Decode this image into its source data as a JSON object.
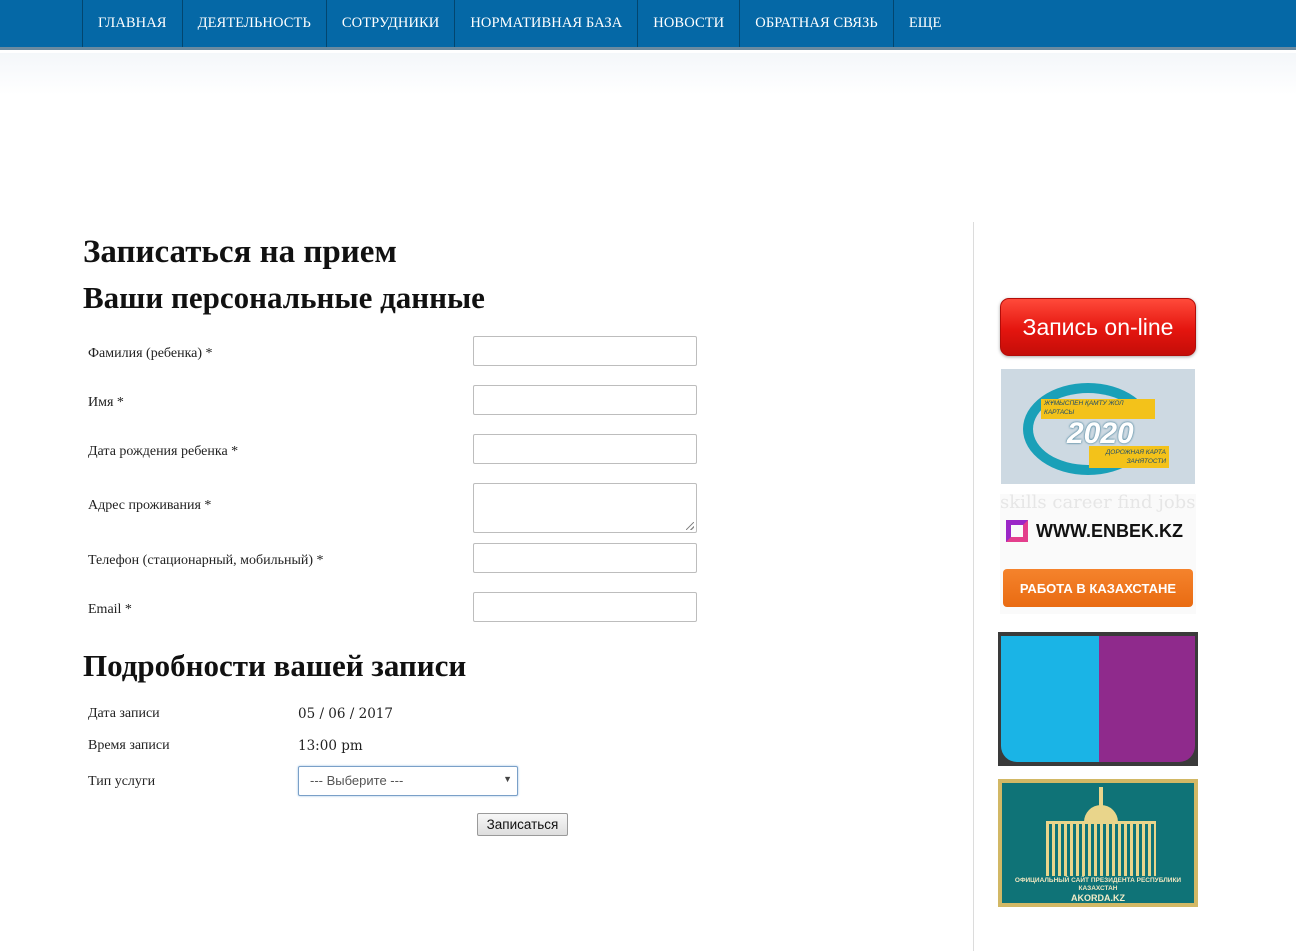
{
  "nav": {
    "items": [
      {
        "label": "ГЛАВНАЯ"
      },
      {
        "label": "ДЕЯТЕЛЬНОСТЬ"
      },
      {
        "label": "СОТРУДНИКИ"
      },
      {
        "label": "НОРМАТИВНАЯ БАЗА"
      },
      {
        "label": "НОВОСТИ"
      },
      {
        "label": "ОБРАТНАЯ СВЯЗЬ"
      },
      {
        "label": "ЕЩЕ"
      }
    ],
    "colors": {
      "background": "#0568a6",
      "divider": "#03466f"
    }
  },
  "page": {
    "title": "Записаться на прием",
    "personal_section_title": "Ваши персональные данные",
    "details_section_title": "Подробности вашей записи"
  },
  "personal_fields": [
    {
      "label": "Фамилия (ребенка) *",
      "value": "",
      "type": "text"
    },
    {
      "label": "Имя *",
      "value": "",
      "type": "text"
    },
    {
      "label": "Дата рождения ребенка *",
      "value": "",
      "type": "text"
    },
    {
      "label": "Адрес проживания *",
      "value": "",
      "type": "textarea"
    },
    {
      "label": "Телефон (стационарный, мобильный) *",
      "value": "",
      "type": "text"
    },
    {
      "label": "Email *",
      "value": "",
      "type": "text"
    }
  ],
  "details": {
    "date_label": "Дата записи",
    "date_value": "05 / 06 / 2017",
    "time_label": "Время записи",
    "time_value": "13:00 pm",
    "service_label": "Тип услуги",
    "service_selected": "--- Выберите ---"
  },
  "submit_label": "Записаться",
  "sidebar": {
    "zapis_label": "Запись on-line",
    "roadmap": {
      "year": "2020",
      "top_text": "ЖҰМЫСПЕН ҚАМТУ ЖОЛ КАРТАСЫ",
      "bottom_text": "ДОРОЖНАЯ КАРТА ЗАНЯТОСТИ"
    },
    "enbek": {
      "url": "WWW.ENBEK.KZ",
      "button": "РАБОТА В КАЗАХСТАНЕ",
      "bg_words": "skills career find jobs career"
    },
    "akorda": {
      "caption": "ОФИЦИАЛЬНЫЙ САЙТ ПРЕЗИДЕНТА РЕСПУБЛИКИ КАЗАХСТАН",
      "site": "AKORDA.KZ"
    },
    "colors": {
      "zapis": "#e4150f",
      "enbek_button": "#f0781f",
      "book_left": "#1ab4e6",
      "book_right": "#8f2a8c",
      "akorda_bg": "#0f7377"
    }
  }
}
